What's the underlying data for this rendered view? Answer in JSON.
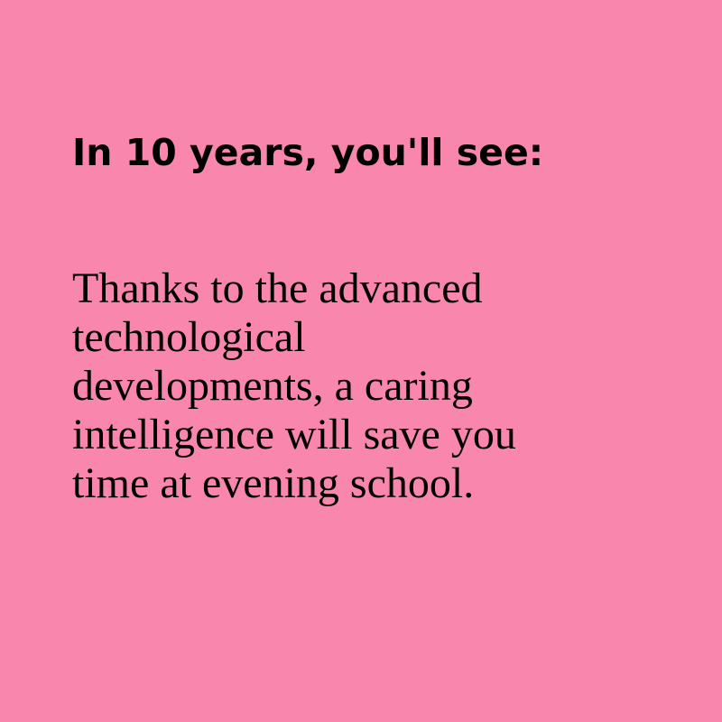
{
  "colors": {
    "background": "#f986ad",
    "text": "#000000"
  },
  "headline": "In 10 years, you'll see:",
  "body_lines": [
    "Thanks to the advanced",
    "technological",
    "developments, a caring",
    "intelligence will save you",
    "time at evening school."
  ]
}
